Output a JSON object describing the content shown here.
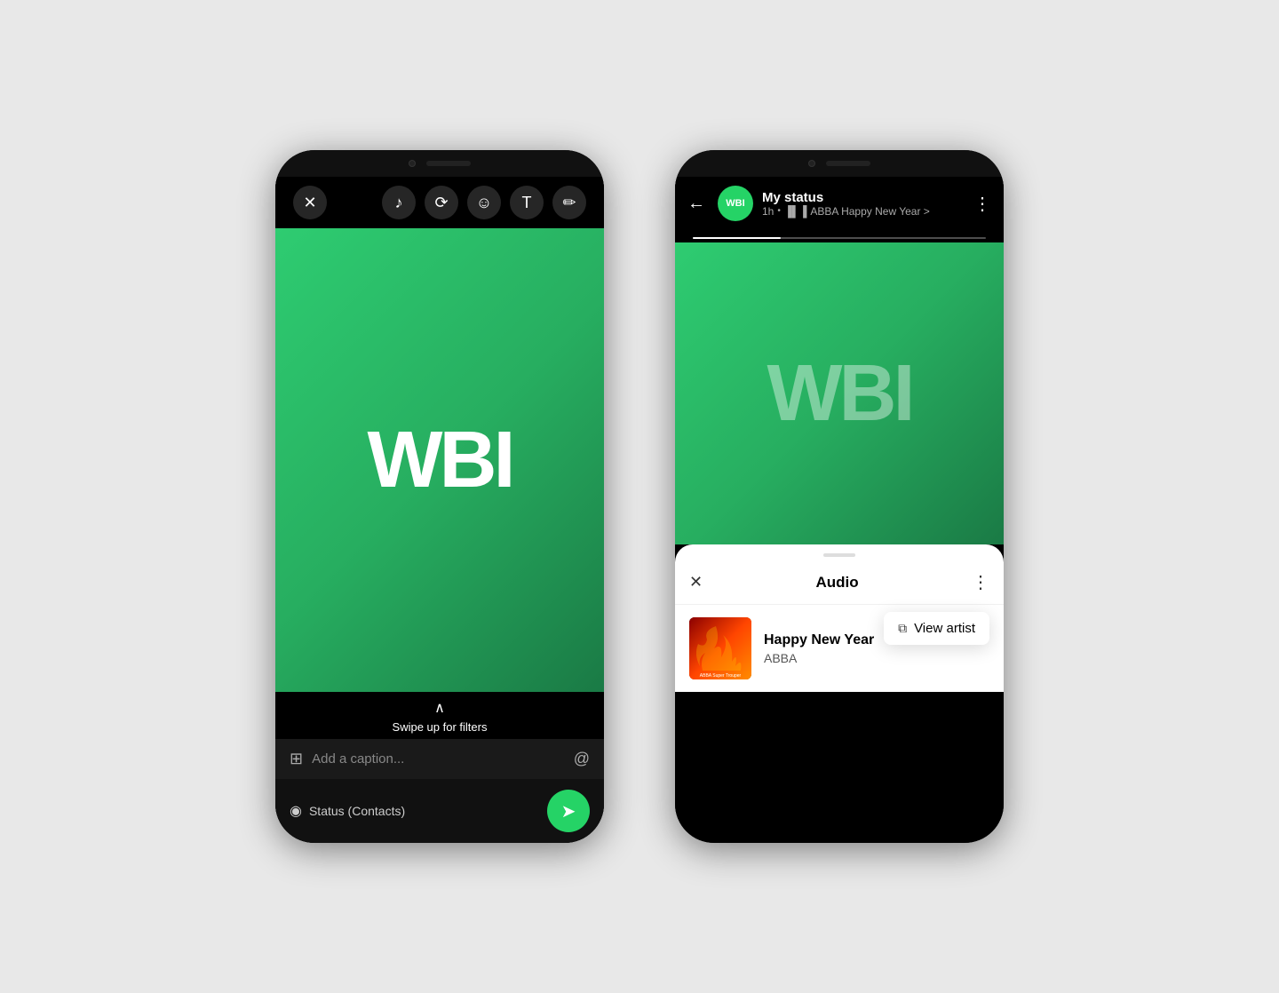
{
  "left_phone": {
    "toolbar": {
      "close_label": "✕",
      "music_icon": "♪",
      "rotate_icon": "⟳",
      "emoji_icon": "☺",
      "text_icon": "T",
      "pencil_icon": "✏"
    },
    "preview": {
      "wbi_text": "WBI",
      "watermark": ""
    },
    "swipe": {
      "chevron": "∧",
      "label": "Swipe up for filters"
    },
    "caption": {
      "icon": "⊞",
      "placeholder": "Add a caption...",
      "at_icon": "@"
    },
    "bottom": {
      "contacts_icon": "◉",
      "contacts_label": "Status (Contacts)",
      "send_icon": "➤"
    }
  },
  "right_phone": {
    "header": {
      "back_icon": "←",
      "avatar_text": "WBI",
      "status_name": "My status",
      "time": "1h",
      "music_bars": "▐▌▐",
      "song_info": "ABBA Happy New Year >",
      "more_icon": "⋮"
    },
    "preview": {
      "wbi_text": "WBI"
    },
    "progress": {
      "fill_percent": 30
    },
    "sheet": {
      "handle": "",
      "close_icon": "✕",
      "title": "Audio",
      "more_icon": "⋮",
      "track_name": "Happy New Year",
      "track_artist": "ABBA",
      "track_label": "ABBA Super Trouper",
      "view_artist_icon": "⧉",
      "view_artist_text": "View artist"
    }
  }
}
